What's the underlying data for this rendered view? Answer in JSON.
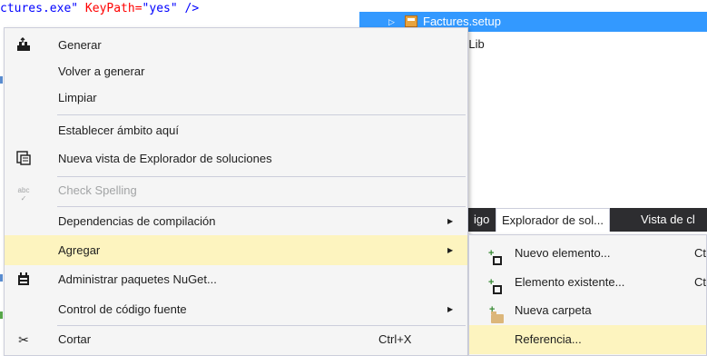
{
  "editor": {
    "code_prefix": "ctures.exe\"",
    "code_attr": "KeyPath=",
    "code_value": "\"yes\"",
    "code_suffix": " />"
  },
  "solution_explorer": {
    "rows": [
      {
        "label": "Factures.setup",
        "selected": true,
        "icon": "setup-project-icon"
      },
      {
        "label": "cialMathLib",
        "selected": false
      }
    ],
    "tabs": [
      {
        "label": "igo"
      },
      {
        "label": "Explorador de sol...",
        "active": true
      },
      {
        "label": "Vista de cl"
      }
    ]
  },
  "context_menu": {
    "items": [
      {
        "label": "Generar",
        "icon": "build-icon",
        "shortcut": "",
        "submenu": false
      },
      {
        "label": "Volver a generar",
        "shortcut": "",
        "submenu": false
      },
      {
        "label": "Limpiar",
        "shortcut": "",
        "submenu": false
      },
      {
        "label": "Establecer ámbito aquí",
        "shortcut": "",
        "submenu": false
      },
      {
        "label": "Nueva vista de Explorador de soluciones",
        "icon": "new-view-icon",
        "shortcut": "",
        "submenu": false
      },
      {
        "label": "Check Spelling",
        "icon": "spell-check-icon",
        "disabled": true,
        "shortcut": "",
        "submenu": false
      },
      {
        "label": "Dependencias de compilación",
        "shortcut": "",
        "submenu": true
      },
      {
        "label": "Agregar",
        "shortcut": "",
        "submenu": true,
        "highlighted": true
      },
      {
        "label": "Administrar paquetes NuGet...",
        "icon": "nuget-icon",
        "shortcut": "",
        "submenu": false
      },
      {
        "label": "Control de código fuente",
        "shortcut": "",
        "submenu": true
      },
      {
        "label": "Cortar",
        "icon": "scissors-icon",
        "shortcut": "Ctrl+X",
        "submenu": false
      }
    ]
  },
  "sub_menu": {
    "items": [
      {
        "label": "Nuevo elemento...",
        "icon": "new-item-icon",
        "shortcut": "Ct"
      },
      {
        "label": "Elemento existente...",
        "icon": "existing-item-icon",
        "shortcut": "Ct"
      },
      {
        "label": "Nueva carpeta",
        "icon": "new-folder-icon",
        "shortcut": ""
      },
      {
        "label": "Referencia...",
        "highlighted": true,
        "shortcut": ""
      }
    ]
  },
  "colors": {
    "selection_blue": "#3399ff",
    "menu_highlight": "#fdf4bf",
    "menu_background": "#f5f5f5",
    "tab_strip": "#2d2d30",
    "xml_attribute": "#ff0000",
    "xml_value": "#0000ff"
  }
}
